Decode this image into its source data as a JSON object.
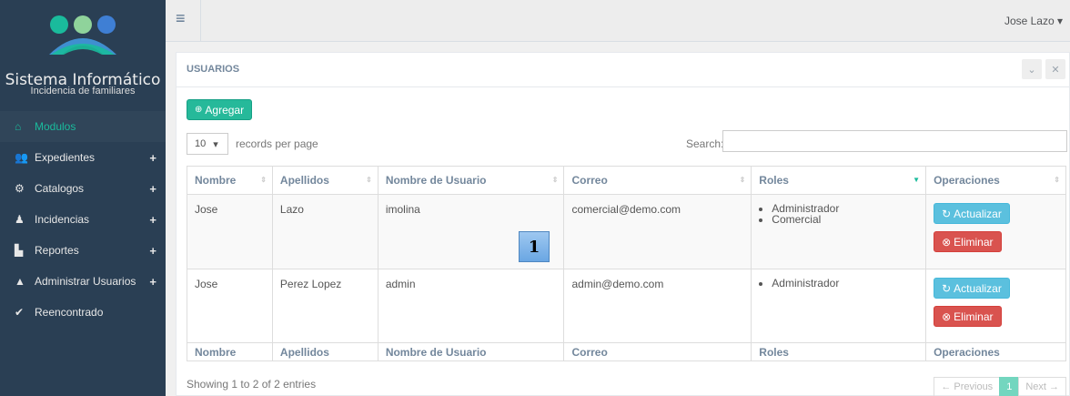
{
  "sidebar": {
    "brand_title": "Sistema Informático",
    "brand_subtitle": "Incidencia de familiares",
    "items": [
      {
        "label": "Modulos",
        "icon": "home-icon",
        "glyph": "⌂",
        "expandable": false
      },
      {
        "label": "Expedientes",
        "icon": "users-icon",
        "glyph": "👥",
        "expandable": true
      },
      {
        "label": "Catalogos",
        "icon": "cogs-icon",
        "glyph": "⚙",
        "expandable": true
      },
      {
        "label": "Incidencias",
        "icon": "person-icon",
        "glyph": "♟",
        "expandable": true
      },
      {
        "label": "Reportes",
        "icon": "file-icon",
        "glyph": "▙",
        "expandable": true
      },
      {
        "label": "Administrar Usuarios",
        "icon": "user-icon",
        "glyph": "▲",
        "expandable": true
      },
      {
        "label": "Reencontrado",
        "icon": "check-icon",
        "glyph": "✔",
        "expandable": false
      }
    ],
    "plus_glyph": "+"
  },
  "topbar": {
    "menu_glyph": "≡",
    "user": "Jose Lazo ▾"
  },
  "panel": {
    "title": "USUARIOS",
    "collapse_glyph": "⌄",
    "close_glyph": "✕",
    "add_label": "Agregar",
    "add_glyph": "⊕",
    "page_length": "10",
    "page_length_caret": "▾",
    "records_per_page": "records per page",
    "search_label": "Search:",
    "search_value": ""
  },
  "table": {
    "headers": [
      "Nombre",
      "Apellidos",
      "Nombre de Usuario",
      "Correo",
      "Roles",
      "Operaciones"
    ],
    "sort_glyph": "⇕",
    "sorted_glyph": "▼",
    "rows": [
      {
        "nombre": "Jose",
        "apellidos": "Lazo",
        "usuario": "imolina",
        "correo": "comercial@demo.com",
        "roles": [
          "Administrador",
          "Comercial"
        ]
      },
      {
        "nombre": "Jose",
        "apellidos": "Perez Lopez",
        "usuario": "admin",
        "correo": "admin@demo.com",
        "roles": [
          "Administrador"
        ]
      }
    ],
    "update_label": "Actualizar",
    "update_glyph": "↻",
    "delete_label": "Eliminar",
    "delete_glyph": "⊗",
    "marker_label": "1"
  },
  "footer": {
    "info": "Showing 1 to 2 of 2 entries",
    "previous": "← Previous",
    "current_page": "1",
    "next": "Next →"
  },
  "colors": {
    "sidebar_bg": "#2a3f54",
    "accent": "#1abb9c",
    "add_button": "#26b99a",
    "update_button": "#5bc0de",
    "delete_button": "#d9534f"
  }
}
